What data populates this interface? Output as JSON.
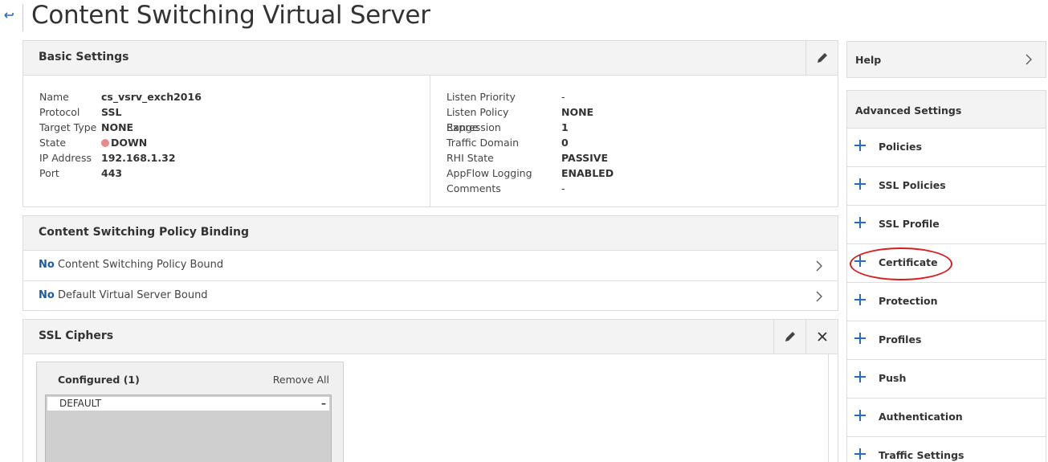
{
  "page": {
    "title": "Content Switching Virtual Server",
    "back_icon": "back-arrow-icon"
  },
  "basic_settings": {
    "title": "Basic Settings",
    "left": [
      {
        "key": "Name",
        "value": "cs_vsrv_exch2016"
      },
      {
        "key": "Protocol",
        "value": "SSL"
      },
      {
        "key": "Target Type",
        "value": "NONE"
      },
      {
        "key": "State",
        "value": "DOWN"
      },
      {
        "key": "IP Address",
        "value": "192.168.1.32"
      },
      {
        "key": "Port",
        "value": "443"
      }
    ],
    "right": [
      {
        "key": "Listen Priority",
        "value": "-"
      },
      {
        "key": "Listen Policy Expression",
        "value": "NONE"
      },
      {
        "key": "Range",
        "value": "1"
      },
      {
        "key": "Traffic Domain",
        "value": "0"
      },
      {
        "key": "RHI State",
        "value": "PASSIVE"
      },
      {
        "key": "AppFlow Logging",
        "value": "ENABLED"
      },
      {
        "key": "Comments",
        "value": "-"
      }
    ],
    "state_color": "#e88a8a"
  },
  "cs_policy_binding": {
    "title": "Content Switching Policy Binding",
    "rows": [
      {
        "prefix": "No",
        "text": "Content Switching Policy Bound"
      },
      {
        "prefix": "No",
        "text": "Default Virtual Server Bound"
      }
    ]
  },
  "ssl_ciphers": {
    "title": "SSL Ciphers",
    "configured_label": "Configured (1)",
    "remove_all": "Remove All",
    "items": [
      "DEFAULT"
    ],
    "remove_symbol": "–"
  },
  "sidebar": {
    "help_label": "Help",
    "advanced_title": "Advanced Settings",
    "items": [
      "Policies",
      "SSL Policies",
      "SSL Profile",
      "Certificate",
      "Protection",
      "Profiles",
      "Push",
      "Authentication",
      "Traffic Settings"
    ]
  },
  "colors": {
    "accent": "#2a6eb4",
    "link_bold": "#1b5c9e",
    "highlight": "#d42020",
    "header_bg": "#f3f3f3"
  }
}
